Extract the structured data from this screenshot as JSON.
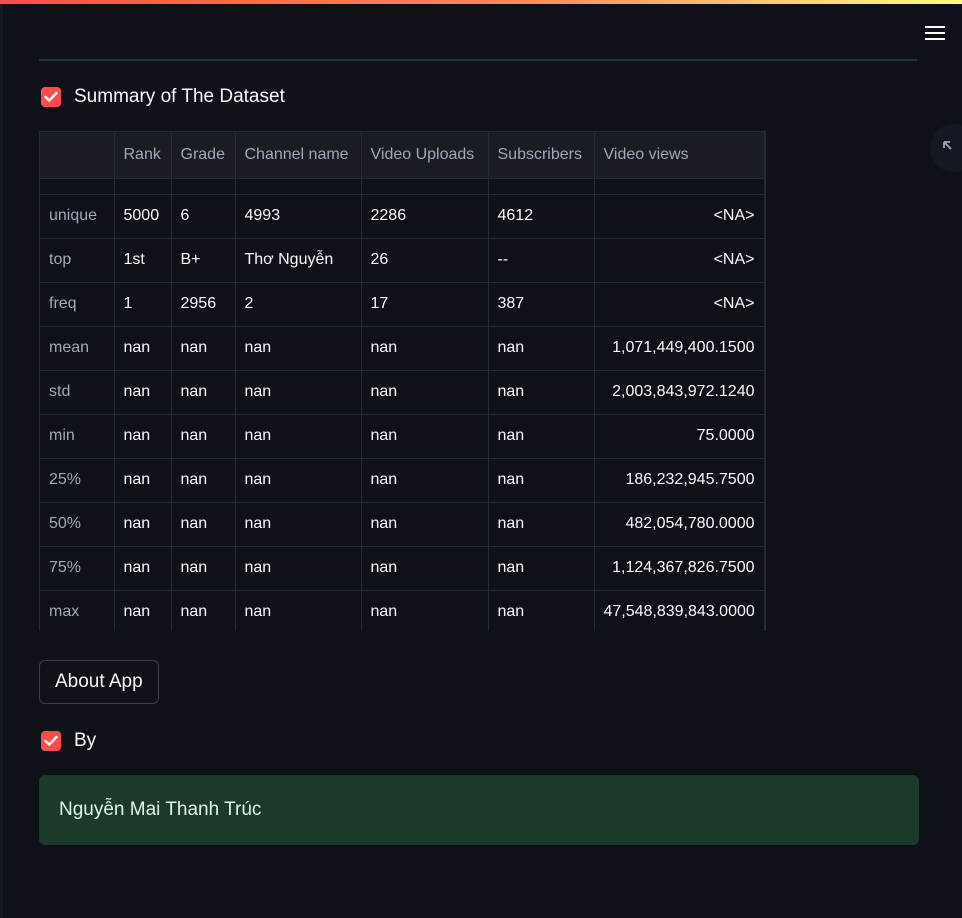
{
  "toolbar": {
    "menu_icon": "hamburger-menu-icon",
    "expand_icon": "expand-arrows-icon"
  },
  "summary_checkbox": {
    "label": "Summary of The Dataset",
    "checked": true
  },
  "table": {
    "columns": [
      "",
      "Rank",
      "Grade",
      "Channel name",
      "Video Uploads",
      "Subscribers",
      "Video views"
    ],
    "rows": [
      {
        "label": "unique",
        "cells": [
          "5000",
          "6",
          "4993",
          "2286",
          "4612",
          "<NA>"
        ]
      },
      {
        "label": "top",
        "cells": [
          "1st",
          "B+",
          "Thơ Nguyễn",
          "26",
          "--",
          "<NA>"
        ]
      },
      {
        "label": "freq",
        "cells": [
          "1",
          "2956",
          "2",
          "17",
          "387",
          "<NA>"
        ]
      },
      {
        "label": "mean",
        "cells": [
          "nan",
          "nan",
          "nan",
          "nan",
          "nan",
          "1,071,449,400.1500"
        ]
      },
      {
        "label": "std",
        "cells": [
          "nan",
          "nan",
          "nan",
          "nan",
          "nan",
          "2,003,843,972.1240"
        ]
      },
      {
        "label": "min",
        "cells": [
          "nan",
          "nan",
          "nan",
          "nan",
          "nan",
          "75.0000"
        ]
      },
      {
        "label": "25%",
        "cells": [
          "nan",
          "nan",
          "nan",
          "nan",
          "nan",
          "186,232,945.7500"
        ]
      },
      {
        "label": "50%",
        "cells": [
          "nan",
          "nan",
          "nan",
          "nan",
          "nan",
          "482,054,780.0000"
        ]
      },
      {
        "label": "75%",
        "cells": [
          "nan",
          "nan",
          "nan",
          "nan",
          "nan",
          "1,124,367,826.7500"
        ]
      },
      {
        "label": "max",
        "cells": [
          "nan",
          "nan",
          "nan",
          "nan",
          "nan",
          "47,548,839,843.0000"
        ]
      }
    ]
  },
  "about_button": {
    "label": "About App"
  },
  "by_checkbox": {
    "label": "By",
    "checked": true
  },
  "author": {
    "name": "Nguyễn Mai Thanh Trúc"
  },
  "colors": {
    "accent": "#ff4b4b",
    "background": "#0e1117",
    "success_box": "#1b3a2a"
  }
}
